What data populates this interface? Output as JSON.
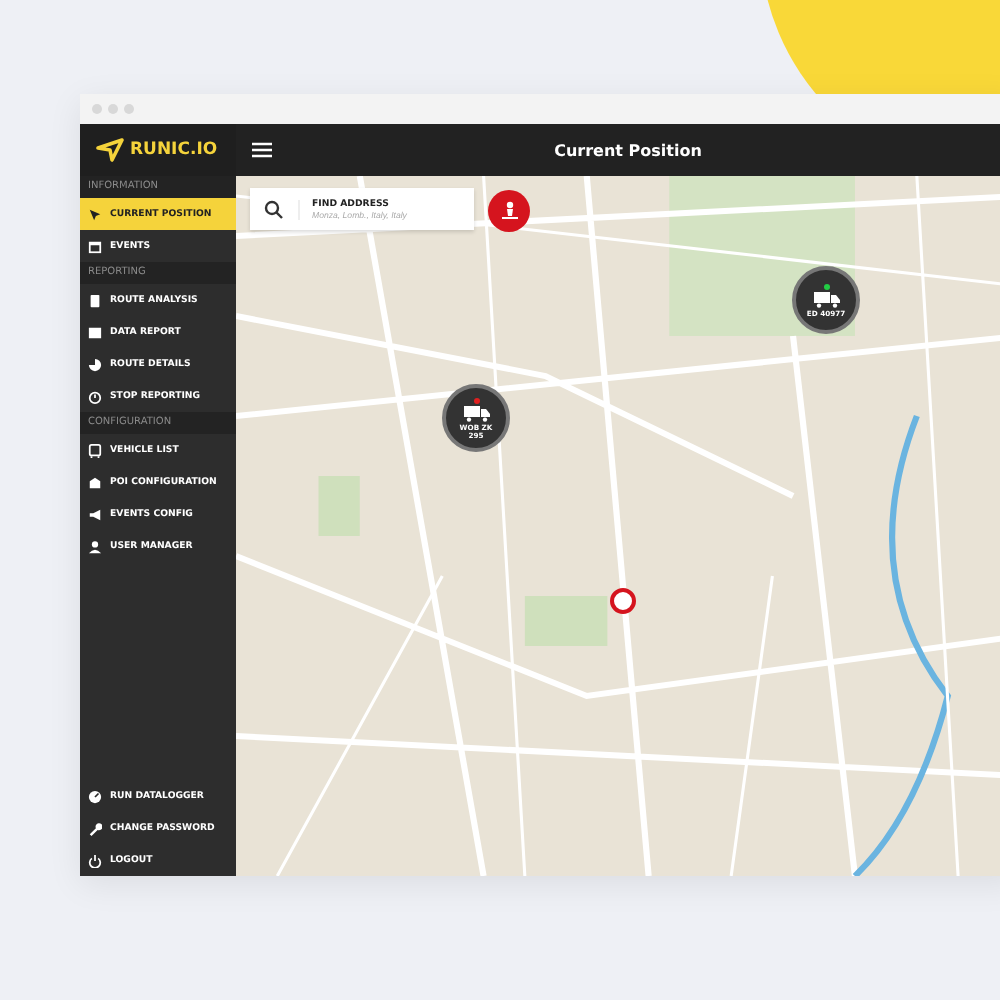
{
  "brand": "RUNIC.IO",
  "header": {
    "title": "Current Position"
  },
  "sidebar": {
    "sections": [
      {
        "heading": "INFORMATION",
        "items": [
          {
            "label": "CURRENT POSITION",
            "selected": true
          },
          {
            "label": "EVENTS",
            "selected": false
          }
        ]
      },
      {
        "heading": "REPORTING",
        "items": [
          {
            "label": "ROUTE ANALYSIS",
            "selected": false
          },
          {
            "label": "DATA REPORT",
            "selected": false
          },
          {
            "label": "ROUTE DETAILS",
            "selected": false
          },
          {
            "label": "STOP REPORTING",
            "selected": false
          }
        ]
      },
      {
        "heading": "CONFIGURATION",
        "items": [
          {
            "label": "VEHICLE LIST",
            "selected": false
          },
          {
            "label": "POI CONFIGURATION",
            "selected": false
          },
          {
            "label": "EVENTS CONFIG",
            "selected": false
          },
          {
            "label": "USER MANAGER",
            "selected": false
          }
        ]
      }
    ],
    "footer": [
      {
        "label": "RUN DATALOGGER"
      },
      {
        "label": "CHANGE PASSWORD"
      },
      {
        "label": "LOGOUT"
      }
    ]
  },
  "search": {
    "label": "FIND ADDRESS",
    "placeholder": "Monza, Lomb., Italy, Italy"
  },
  "vehicles": [
    {
      "plate": "WOB ZK 295",
      "color": "#e02020"
    },
    {
      "plate": "ED 40977",
      "color": "#22cc44"
    }
  ]
}
